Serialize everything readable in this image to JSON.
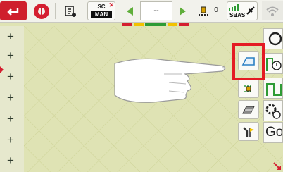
{
  "topbar": {
    "back_icon": "return-arrow-icon",
    "steering_icon": "steering-wheel-icon",
    "tool_icon": "implement-settings-icon",
    "section_control": {
      "line1": "SC",
      "line2": "MAN",
      "status_icon": "x-mark-icon"
    },
    "field_value": "--",
    "counter": "0",
    "gps_label": "SBAS",
    "wifi_icon": "wifi-icon"
  },
  "lanebar_colors": [
    "#d41f30",
    "#f2c200",
    "#2e9b35",
    "#f2c200",
    "#d41f30"
  ],
  "left_column": {
    "plus_items": [
      "+",
      "+",
      "+",
      "+",
      "+",
      "+",
      "+",
      "+"
    ]
  },
  "right_column": {
    "buttons": [
      "boundary-icon",
      "headland-icon",
      "field-machine-icon",
      "gear-settings-icon",
      "wrench-flag-icon"
    ],
    "go_label": "Go"
  },
  "colors": {
    "accent": "#d41f30",
    "map_background": "#dfe3b4",
    "highlight": "#e41b23"
  }
}
